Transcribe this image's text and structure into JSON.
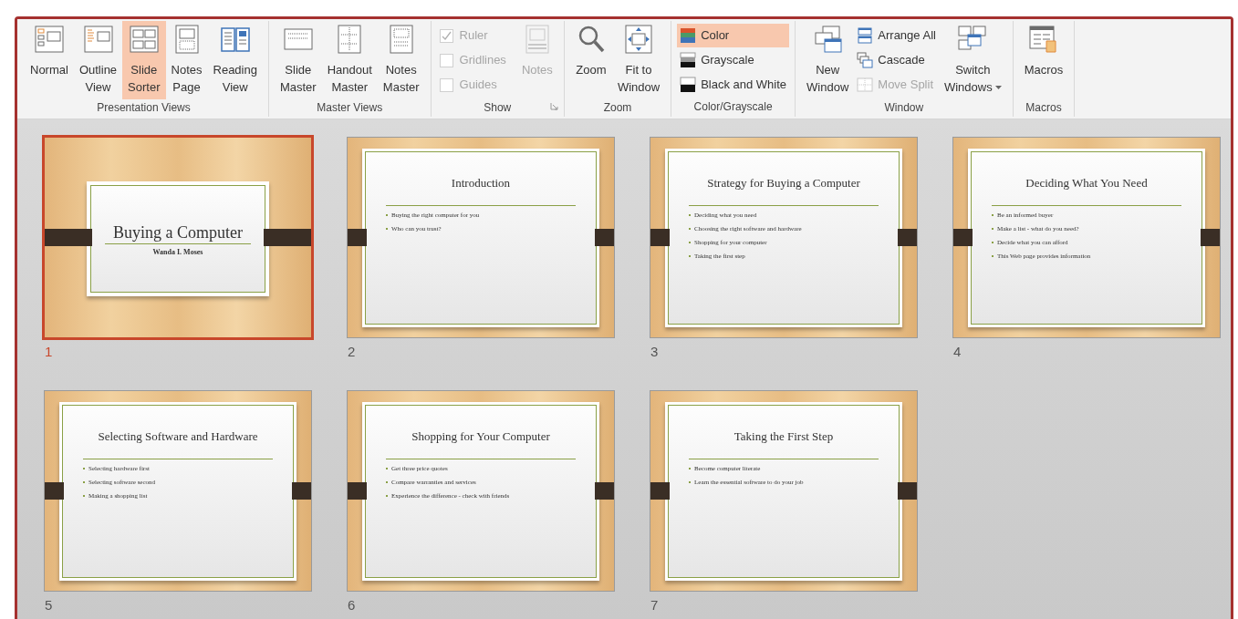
{
  "ribbon": {
    "groups": [
      {
        "label": "Presentation Views",
        "launcher": false,
        "items": [
          {
            "kind": "large",
            "lines": [
              "Normal"
            ],
            "selected": false,
            "disabled": false,
            "dropdown": false
          },
          {
            "kind": "large",
            "lines": [
              "Outline",
              "View"
            ],
            "selected": false,
            "disabled": false,
            "dropdown": false
          },
          {
            "kind": "large",
            "lines": [
              "Slide",
              "Sorter"
            ],
            "selected": true,
            "disabled": false,
            "dropdown": false
          },
          {
            "kind": "large",
            "lines": [
              "Notes",
              "Page"
            ],
            "selected": false,
            "disabled": false,
            "dropdown": false
          },
          {
            "kind": "large",
            "lines": [
              "Reading",
              "View"
            ],
            "selected": false,
            "disabled": false,
            "dropdown": false
          }
        ]
      },
      {
        "label": "Master Views",
        "launcher": false,
        "items": [
          {
            "kind": "large",
            "lines": [
              "Slide",
              "Master"
            ],
            "selected": false,
            "disabled": false,
            "dropdown": false
          },
          {
            "kind": "large",
            "lines": [
              "Handout",
              "Master"
            ],
            "selected": false,
            "disabled": false,
            "dropdown": false
          },
          {
            "kind": "large",
            "lines": [
              "Notes",
              "Master"
            ],
            "selected": false,
            "disabled": false,
            "dropdown": false
          }
        ]
      },
      {
        "label": "Show",
        "launcher": true,
        "items": [
          {
            "kind": "checks",
            "options": [
              {
                "label": "Ruler",
                "checked": true,
                "disabled": true
              },
              {
                "label": "Gridlines",
                "checked": false,
                "disabled": true
              },
              {
                "label": "Guides",
                "checked": false,
                "disabled": true
              }
            ]
          },
          {
            "kind": "large",
            "lines": [
              "Notes"
            ],
            "selected": false,
            "disabled": true,
            "dropdown": false
          }
        ]
      },
      {
        "label": "Zoom",
        "launcher": false,
        "items": [
          {
            "kind": "large",
            "lines": [
              "Zoom"
            ],
            "selected": false,
            "disabled": false,
            "dropdown": false
          },
          {
            "kind": "large",
            "lines": [
              "Fit to",
              "Window"
            ],
            "selected": false,
            "disabled": false,
            "dropdown": false
          }
        ]
      },
      {
        "label": "Color/Grayscale",
        "launcher": false,
        "items": [
          {
            "kind": "smalls",
            "buttons": [
              {
                "label": "Color",
                "selected": true,
                "disabled": false
              },
              {
                "label": "Grayscale",
                "selected": false,
                "disabled": false
              },
              {
                "label": "Black and White",
                "selected": false,
                "disabled": false
              }
            ]
          }
        ]
      },
      {
        "label": "Window",
        "launcher": false,
        "items": [
          {
            "kind": "large",
            "lines": [
              "New",
              "Window"
            ],
            "selected": false,
            "disabled": false,
            "dropdown": false
          },
          {
            "kind": "smalls",
            "buttons": [
              {
                "label": "Arrange All",
                "selected": false,
                "disabled": false
              },
              {
                "label": "Cascade",
                "selected": false,
                "disabled": false
              },
              {
                "label": "Move Split",
                "selected": false,
                "disabled": true
              }
            ]
          },
          {
            "kind": "large",
            "lines": [
              "Switch",
              "Windows"
            ],
            "selected": false,
            "disabled": false,
            "dropdown": true
          }
        ]
      },
      {
        "label": "Macros",
        "launcher": false,
        "items": [
          {
            "kind": "large",
            "lines": [
              "Macros"
            ],
            "selected": false,
            "disabled": false,
            "dropdown": false
          }
        ]
      }
    ]
  },
  "slides": [
    {
      "number": "1",
      "kind": "title",
      "selected": true,
      "title": "Buying a Computer",
      "subtitle": "Wanda I. Moses"
    },
    {
      "number": "2",
      "kind": "content",
      "selected": false,
      "title": "Introduction",
      "bullets": [
        "Buying the right computer for you",
        "Who can you trust?"
      ]
    },
    {
      "number": "3",
      "kind": "content",
      "selected": false,
      "title": "Strategy for Buying a Computer",
      "bullets": [
        "Deciding what you need",
        "Choosing the right software and hardware",
        "Shopping for your computer",
        "Taking the first step"
      ]
    },
    {
      "number": "4",
      "kind": "content",
      "selected": false,
      "title": "Deciding What You Need",
      "bullets": [
        "Be an informed buyer",
        "Make a list - what do you need?",
        "Decide what you can afford",
        "This Web page provides information"
      ]
    },
    {
      "number": "5",
      "kind": "content",
      "selected": false,
      "title": "Selecting Software and Hardware",
      "bullets": [
        "Selecting hardware first",
        "Selecting software second",
        "Making a shopping list"
      ]
    },
    {
      "number": "6",
      "kind": "content",
      "selected": false,
      "title": "Shopping for Your Computer",
      "bullets": [
        "Get three price quotes",
        "Compare warranties and services",
        "Experience the difference - check with friends"
      ]
    },
    {
      "number": "7",
      "kind": "content",
      "selected": false,
      "title": "Taking the First Step",
      "bullets": [
        "Become computer literate",
        "Learn the essential software to do your job"
      ]
    }
  ]
}
